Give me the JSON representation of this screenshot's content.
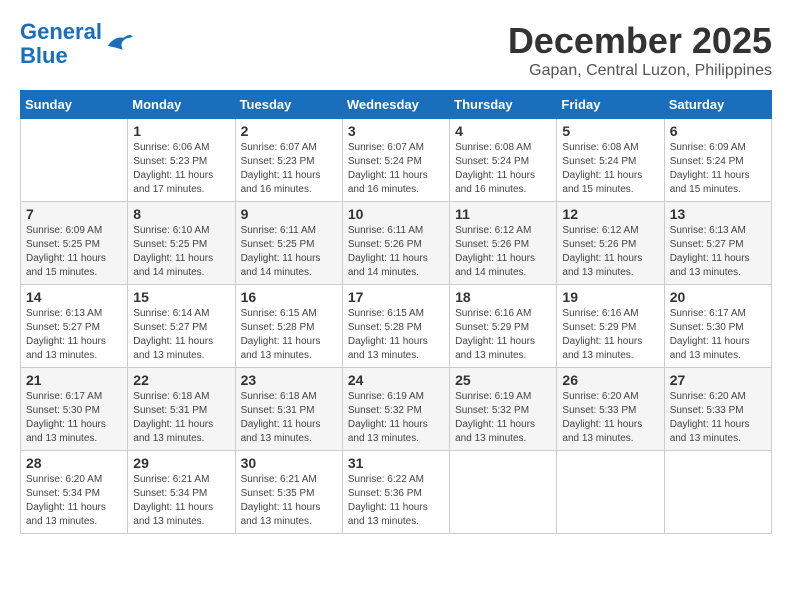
{
  "header": {
    "logo_line1": "General",
    "logo_line2": "Blue",
    "month": "December 2025",
    "location": "Gapan, Central Luzon, Philippines"
  },
  "weekdays": [
    "Sunday",
    "Monday",
    "Tuesday",
    "Wednesday",
    "Thursday",
    "Friday",
    "Saturday"
  ],
  "weeks": [
    [
      {
        "day": "",
        "info": ""
      },
      {
        "day": "1",
        "info": "Sunrise: 6:06 AM\nSunset: 5:23 PM\nDaylight: 11 hours\nand 17 minutes."
      },
      {
        "day": "2",
        "info": "Sunrise: 6:07 AM\nSunset: 5:23 PM\nDaylight: 11 hours\nand 16 minutes."
      },
      {
        "day": "3",
        "info": "Sunrise: 6:07 AM\nSunset: 5:24 PM\nDaylight: 11 hours\nand 16 minutes."
      },
      {
        "day": "4",
        "info": "Sunrise: 6:08 AM\nSunset: 5:24 PM\nDaylight: 11 hours\nand 16 minutes."
      },
      {
        "day": "5",
        "info": "Sunrise: 6:08 AM\nSunset: 5:24 PM\nDaylight: 11 hours\nand 15 minutes."
      },
      {
        "day": "6",
        "info": "Sunrise: 6:09 AM\nSunset: 5:24 PM\nDaylight: 11 hours\nand 15 minutes."
      }
    ],
    [
      {
        "day": "7",
        "info": "Sunrise: 6:09 AM\nSunset: 5:25 PM\nDaylight: 11 hours\nand 15 minutes."
      },
      {
        "day": "8",
        "info": "Sunrise: 6:10 AM\nSunset: 5:25 PM\nDaylight: 11 hours\nand 14 minutes."
      },
      {
        "day": "9",
        "info": "Sunrise: 6:11 AM\nSunset: 5:25 PM\nDaylight: 11 hours\nand 14 minutes."
      },
      {
        "day": "10",
        "info": "Sunrise: 6:11 AM\nSunset: 5:26 PM\nDaylight: 11 hours\nand 14 minutes."
      },
      {
        "day": "11",
        "info": "Sunrise: 6:12 AM\nSunset: 5:26 PM\nDaylight: 11 hours\nand 14 minutes."
      },
      {
        "day": "12",
        "info": "Sunrise: 6:12 AM\nSunset: 5:26 PM\nDaylight: 11 hours\nand 13 minutes."
      },
      {
        "day": "13",
        "info": "Sunrise: 6:13 AM\nSunset: 5:27 PM\nDaylight: 11 hours\nand 13 minutes."
      }
    ],
    [
      {
        "day": "14",
        "info": "Sunrise: 6:13 AM\nSunset: 5:27 PM\nDaylight: 11 hours\nand 13 minutes."
      },
      {
        "day": "15",
        "info": "Sunrise: 6:14 AM\nSunset: 5:27 PM\nDaylight: 11 hours\nand 13 minutes."
      },
      {
        "day": "16",
        "info": "Sunrise: 6:15 AM\nSunset: 5:28 PM\nDaylight: 11 hours\nand 13 minutes."
      },
      {
        "day": "17",
        "info": "Sunrise: 6:15 AM\nSunset: 5:28 PM\nDaylight: 11 hours\nand 13 minutes."
      },
      {
        "day": "18",
        "info": "Sunrise: 6:16 AM\nSunset: 5:29 PM\nDaylight: 11 hours\nand 13 minutes."
      },
      {
        "day": "19",
        "info": "Sunrise: 6:16 AM\nSunset: 5:29 PM\nDaylight: 11 hours\nand 13 minutes."
      },
      {
        "day": "20",
        "info": "Sunrise: 6:17 AM\nSunset: 5:30 PM\nDaylight: 11 hours\nand 13 minutes."
      }
    ],
    [
      {
        "day": "21",
        "info": "Sunrise: 6:17 AM\nSunset: 5:30 PM\nDaylight: 11 hours\nand 13 minutes."
      },
      {
        "day": "22",
        "info": "Sunrise: 6:18 AM\nSunset: 5:31 PM\nDaylight: 11 hours\nand 13 minutes."
      },
      {
        "day": "23",
        "info": "Sunrise: 6:18 AM\nSunset: 5:31 PM\nDaylight: 11 hours\nand 13 minutes."
      },
      {
        "day": "24",
        "info": "Sunrise: 6:19 AM\nSunset: 5:32 PM\nDaylight: 11 hours\nand 13 minutes."
      },
      {
        "day": "25",
        "info": "Sunrise: 6:19 AM\nSunset: 5:32 PM\nDaylight: 11 hours\nand 13 minutes."
      },
      {
        "day": "26",
        "info": "Sunrise: 6:20 AM\nSunset: 5:33 PM\nDaylight: 11 hours\nand 13 minutes."
      },
      {
        "day": "27",
        "info": "Sunrise: 6:20 AM\nSunset: 5:33 PM\nDaylight: 11 hours\nand 13 minutes."
      }
    ],
    [
      {
        "day": "28",
        "info": "Sunrise: 6:20 AM\nSunset: 5:34 PM\nDaylight: 11 hours\nand 13 minutes."
      },
      {
        "day": "29",
        "info": "Sunrise: 6:21 AM\nSunset: 5:34 PM\nDaylight: 11 hours\nand 13 minutes."
      },
      {
        "day": "30",
        "info": "Sunrise: 6:21 AM\nSunset: 5:35 PM\nDaylight: 11 hours\nand 13 minutes."
      },
      {
        "day": "31",
        "info": "Sunrise: 6:22 AM\nSunset: 5:36 PM\nDaylight: 11 hours\nand 13 minutes."
      },
      {
        "day": "",
        "info": ""
      },
      {
        "day": "",
        "info": ""
      },
      {
        "day": "",
        "info": ""
      }
    ]
  ]
}
